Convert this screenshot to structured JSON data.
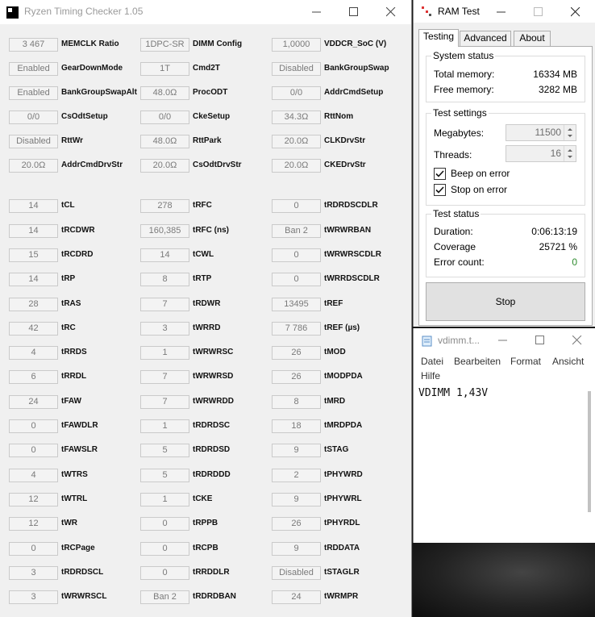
{
  "rtc": {
    "title": "Ryzen Timing Checker 1.05",
    "rows": [
      [
        [
          "3 467",
          "MEMCLK Ratio"
        ],
        [
          "1DPC-SR",
          "DIMM Config"
        ],
        [
          "1,0000",
          "VDDCR_SoC (V)"
        ]
      ],
      [
        [
          "Enabled",
          "GearDownMode"
        ],
        [
          "1T",
          "Cmd2T"
        ],
        [
          "Disabled",
          "BankGroupSwap"
        ]
      ],
      [
        [
          "Enabled",
          "BankGroupSwapAlt"
        ],
        [
          "48.0Ω",
          "ProcODT"
        ],
        [
          "0/0",
          "AddrCmdSetup"
        ]
      ],
      [
        [
          "0/0",
          "CsOdtSetup"
        ],
        [
          "0/0",
          "CkeSetup"
        ],
        [
          "34.3Ω",
          "RttNom"
        ]
      ],
      [
        [
          "Disabled",
          "RttWr"
        ],
        [
          "48.0Ω",
          "RttPark"
        ],
        [
          "20.0Ω",
          "CLKDrvStr"
        ]
      ],
      [
        [
          "20.0Ω",
          "AddrCmdDrvStr"
        ],
        [
          "20.0Ω",
          "CsOdtDrvStr"
        ],
        [
          "20.0Ω",
          "CKEDrvStr"
        ]
      ],
      [
        [
          "14",
          "tCL"
        ],
        [
          "278",
          "tRFC"
        ],
        [
          "0",
          "tRDRDSCDLR"
        ]
      ],
      [
        [
          "14",
          "tRCDWR"
        ],
        [
          "160,385",
          "tRFC (ns)"
        ],
        [
          "Ban 2",
          "tWRWRBAN"
        ]
      ],
      [
        [
          "15",
          "tRCDRD"
        ],
        [
          "14",
          "tCWL"
        ],
        [
          "0",
          "tWRWRSCDLR"
        ]
      ],
      [
        [
          "14",
          "tRP"
        ],
        [
          "8",
          "tRTP"
        ],
        [
          "0",
          "tWRRDSCDLR"
        ]
      ],
      [
        [
          "28",
          "tRAS"
        ],
        [
          "7",
          "tRDWR"
        ],
        [
          "13495",
          "tREF"
        ]
      ],
      [
        [
          "42",
          "tRC"
        ],
        [
          "3",
          "tWRRD"
        ],
        [
          "7 786",
          "tREF (µs)"
        ]
      ],
      [
        [
          "4",
          "tRRDS"
        ],
        [
          "1",
          "tWRWRSC"
        ],
        [
          "26",
          "tMOD"
        ]
      ],
      [
        [
          "6",
          "tRRDL"
        ],
        [
          "7",
          "tWRWRSD"
        ],
        [
          "26",
          "tMODPDA"
        ]
      ],
      [
        [
          "24",
          "tFAW"
        ],
        [
          "7",
          "tWRWRDD"
        ],
        [
          "8",
          "tMRD"
        ]
      ],
      [
        [
          "0",
          "tFAWDLR"
        ],
        [
          "1",
          "tRDRDSC"
        ],
        [
          "18",
          "tMRDPDA"
        ]
      ],
      [
        [
          "0",
          "tFAWSLR"
        ],
        [
          "5",
          "tRDRDSD"
        ],
        [
          "9",
          "tSTAG"
        ]
      ],
      [
        [
          "4",
          "tWTRS"
        ],
        [
          "5",
          "tRDRDDD"
        ],
        [
          "2",
          "tPHYWRD"
        ]
      ],
      [
        [
          "12",
          "tWTRL"
        ],
        [
          "1",
          "tCKE"
        ],
        [
          "9",
          "tPHYWRL"
        ]
      ],
      [
        [
          "12",
          "tWR"
        ],
        [
          "0",
          "tRPPB"
        ],
        [
          "26",
          "tPHYRDL"
        ]
      ],
      [
        [
          "0",
          "tRCPage"
        ],
        [
          "0",
          "tRCPB"
        ],
        [
          "9",
          "tRDDATA"
        ]
      ],
      [
        [
          "3",
          "tRDRDSCL"
        ],
        [
          "0",
          "tRRDDLR"
        ],
        [
          "Disabled",
          "tSTAGLR"
        ]
      ],
      [
        [
          "3",
          "tWRWRSCL"
        ],
        [
          "Ban 2",
          "tRDRDBAN"
        ],
        [
          "24",
          "tWRMPR"
        ]
      ]
    ]
  },
  "ramtest": {
    "title": "RAM Test",
    "tabs": [
      "Testing",
      "Advanced",
      "About"
    ],
    "active_tab": "Testing",
    "system_status": {
      "title": "System status",
      "total_label": "Total memory:",
      "total_value": "16334 MB",
      "free_label": "Free memory:",
      "free_value": "3282 MB"
    },
    "test_settings": {
      "title": "Test settings",
      "megabytes_label": "Megabytes:",
      "megabytes_value": "11500",
      "threads_label": "Threads:",
      "threads_value": "16",
      "beep_label": "Beep on error",
      "beep_checked": true,
      "stop_label": "Stop on error",
      "stop_checked": true
    },
    "test_status": {
      "title": "Test status",
      "duration_label": "Duration:",
      "duration_value": "0:06:13:19",
      "coverage_label": "Coverage",
      "coverage_value": "25721 %",
      "errors_label": "Error count:",
      "errors_value": "0",
      "errors_color": "#2e8b2e"
    },
    "stop_button": "Stop"
  },
  "notepad": {
    "title": "vdimm.t...",
    "menu": [
      "Datei",
      "Bearbeiten",
      "Format",
      "Ansicht",
      "Hilfe"
    ],
    "content": "VDIMM 1,43V"
  },
  "icons": {
    "rtc_app": "window-logo-icon",
    "ramtest_app": "ram-test-icon",
    "notepad_app": "notepad-icon"
  }
}
